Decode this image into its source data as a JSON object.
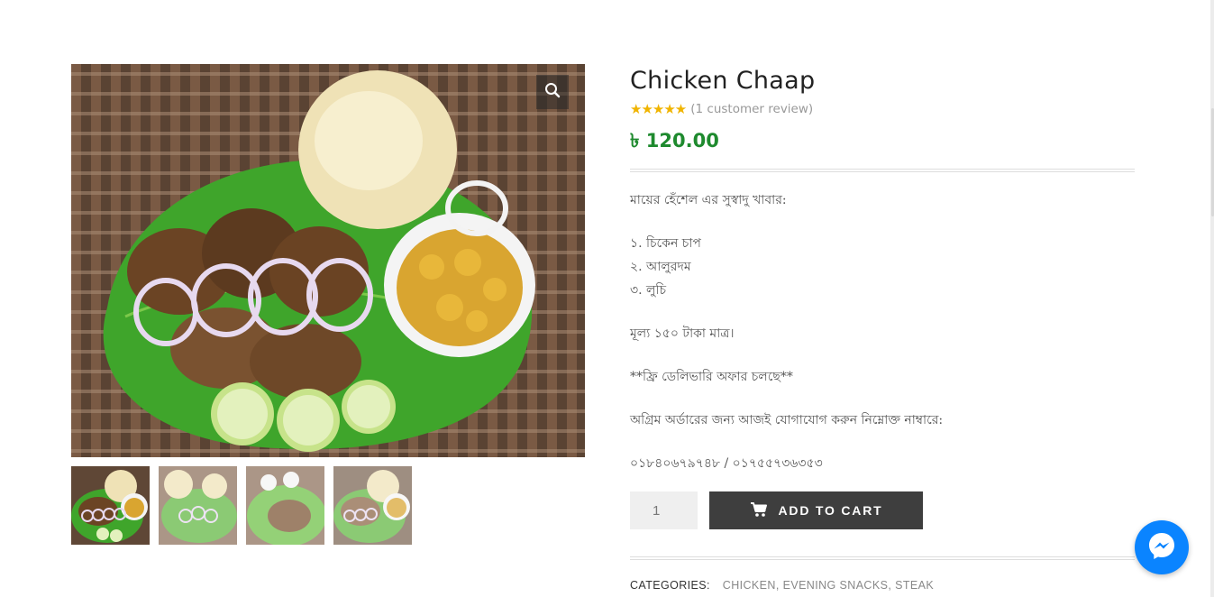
{
  "product": {
    "title": "Chicken Chaap",
    "rating_stars": "★★★★★",
    "review_text": "(1 customer review)",
    "price": "৳ 120.00",
    "description": {
      "intro": "মায়ের হেঁশেল এর সুস্বাদু খাবার:",
      "items": [
        "১. চিকেন চাপ",
        "২. আলুরদম",
        "৩. লুচি"
      ],
      "price_note": "মূল্য ১৫০ টাকা মাত্র।",
      "offer": "**ফ্রি ডেলিভারি অফার চলছে**",
      "contact_note": "অগ্রিম অর্ডারের জন্য আজই যোগাযোগ করুন নিম্নোক্ত নাম্বারে:",
      "phones": "০১৮৪০৬৭৯৭৪৮ / ০১৭৫৫৭৩৬৩৫৩"
    },
    "quantity": "1",
    "add_to_cart_label": "ADD TO CART",
    "categories_label": "CATEGORIES:",
    "categories": [
      "CHICKEN",
      "EVENING SNACKS",
      "STEAK"
    ]
  },
  "icons": {
    "zoom": "magnifier-icon",
    "cart": "cart-icon",
    "messenger": "messenger-icon"
  },
  "colors": {
    "price": "#1e8a2e",
    "stars": "#f0b400",
    "button_bg": "#3e3e3e",
    "messenger": "#0a84ff"
  }
}
